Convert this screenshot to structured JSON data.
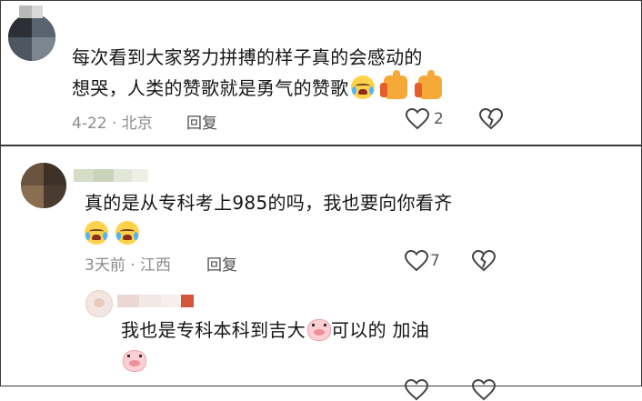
{
  "comments": [
    {
      "text_line1": "每次看到大家努力拼搏的样子真的会感动的",
      "text_line2": "想哭，人类的赞歌就是勇气的赞歌",
      "meta": "4-22 · 北京",
      "reply_label": "回复",
      "like_count": "2",
      "emojis": [
        "crying-face",
        "thumbs-up",
        "thumbs-up"
      ]
    },
    {
      "text_line1": "真的是从专科考上985的吗，我也要向你看齐",
      "meta": "3天前 · 江西",
      "reply_label": "回复",
      "like_count": "7",
      "emojis": [
        "crying-face",
        "crying-face"
      ],
      "replies": [
        {
          "text_part1": "我也是专科本科到吉大",
          "text_part2": "可以的 加油",
          "emojis": [
            "pig-face",
            "pig-face"
          ]
        }
      ]
    }
  ],
  "icons": {
    "like": "heart-icon",
    "dislike": "broken-heart-icon"
  },
  "colors": {
    "meta": "#8c8c8c",
    "text": "#151515",
    "border": "#3a3a3a"
  }
}
